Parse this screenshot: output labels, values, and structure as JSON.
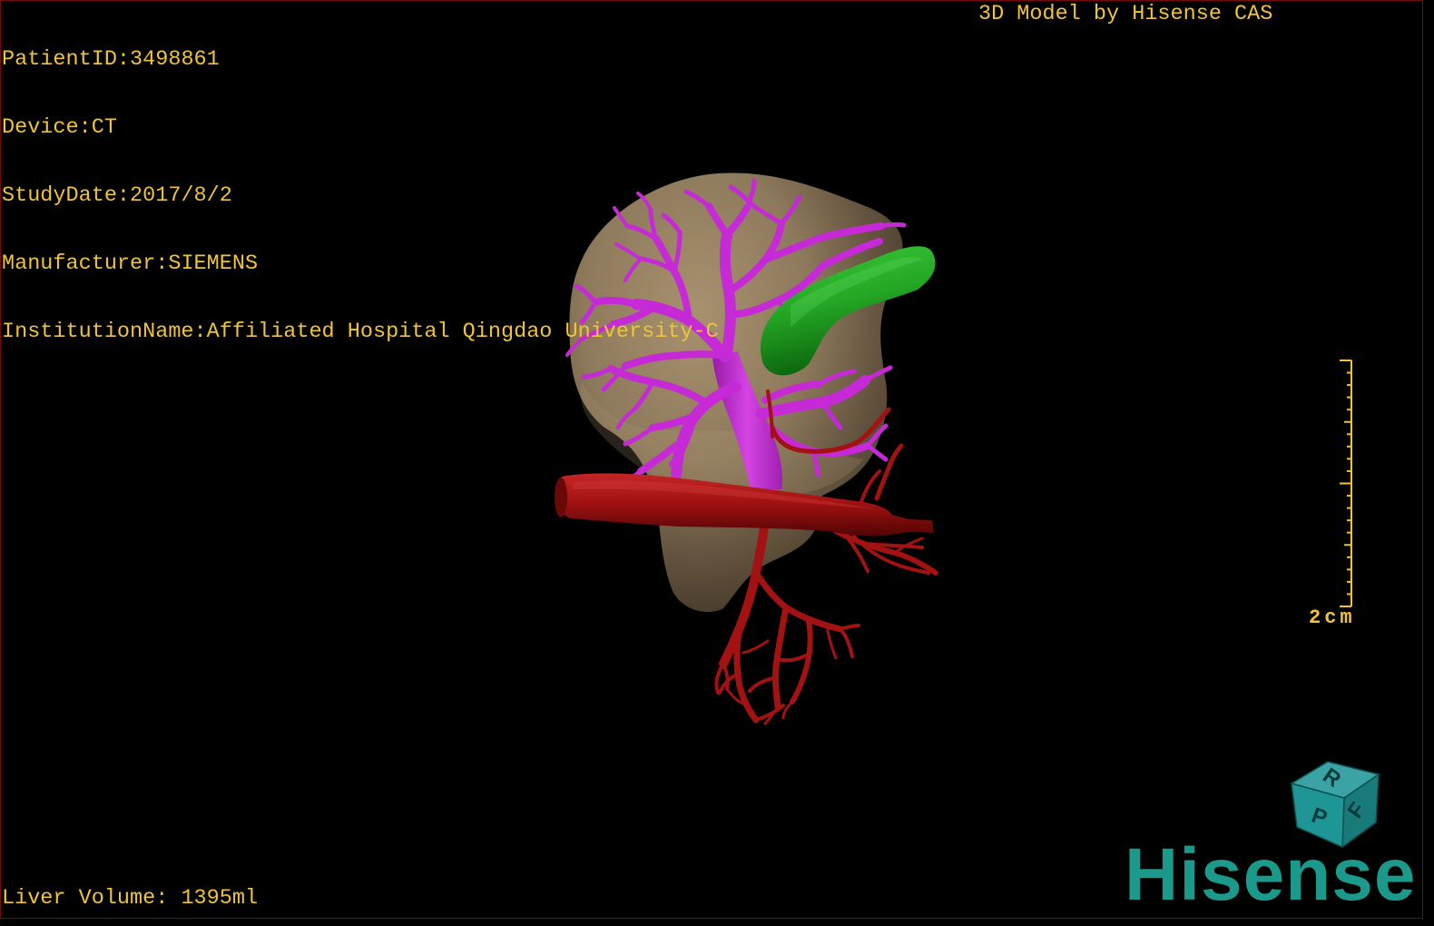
{
  "patient_info": {
    "lines": [
      {
        "label": "PatientID:",
        "value": "3498861"
      },
      {
        "label": "Device:",
        "value": "CT"
      },
      {
        "label": "StudyDate:",
        "value": "2017/8/2"
      },
      {
        "label": "Manufacturer:",
        "value": "SIEMENS"
      },
      {
        "label": "InstitutionName:",
        "value": "Affiliated Hospital Qingdao University-C"
      }
    ]
  },
  "credit": "3D Model by Hisense CAS",
  "measurement": {
    "label": "Liver Volume: ",
    "value": "1395ml"
  },
  "scale_bar": {
    "label": "2cm"
  },
  "orientation_cube": {
    "top_face": "R",
    "right_face": "F",
    "left_face": "P"
  },
  "logo": {
    "text": "Hisense"
  },
  "colors": {
    "overlay_text": "#f0c43a",
    "frame_border": "#7a0a0a",
    "background": "#000000",
    "liver": "#8e7a5c",
    "magenta_vessels": "#c52ad6",
    "green_structure": "#25a825",
    "red_vessels": "#a31212",
    "orientation_cube": "#1f9696",
    "logo": "#1b9a8b"
  }
}
